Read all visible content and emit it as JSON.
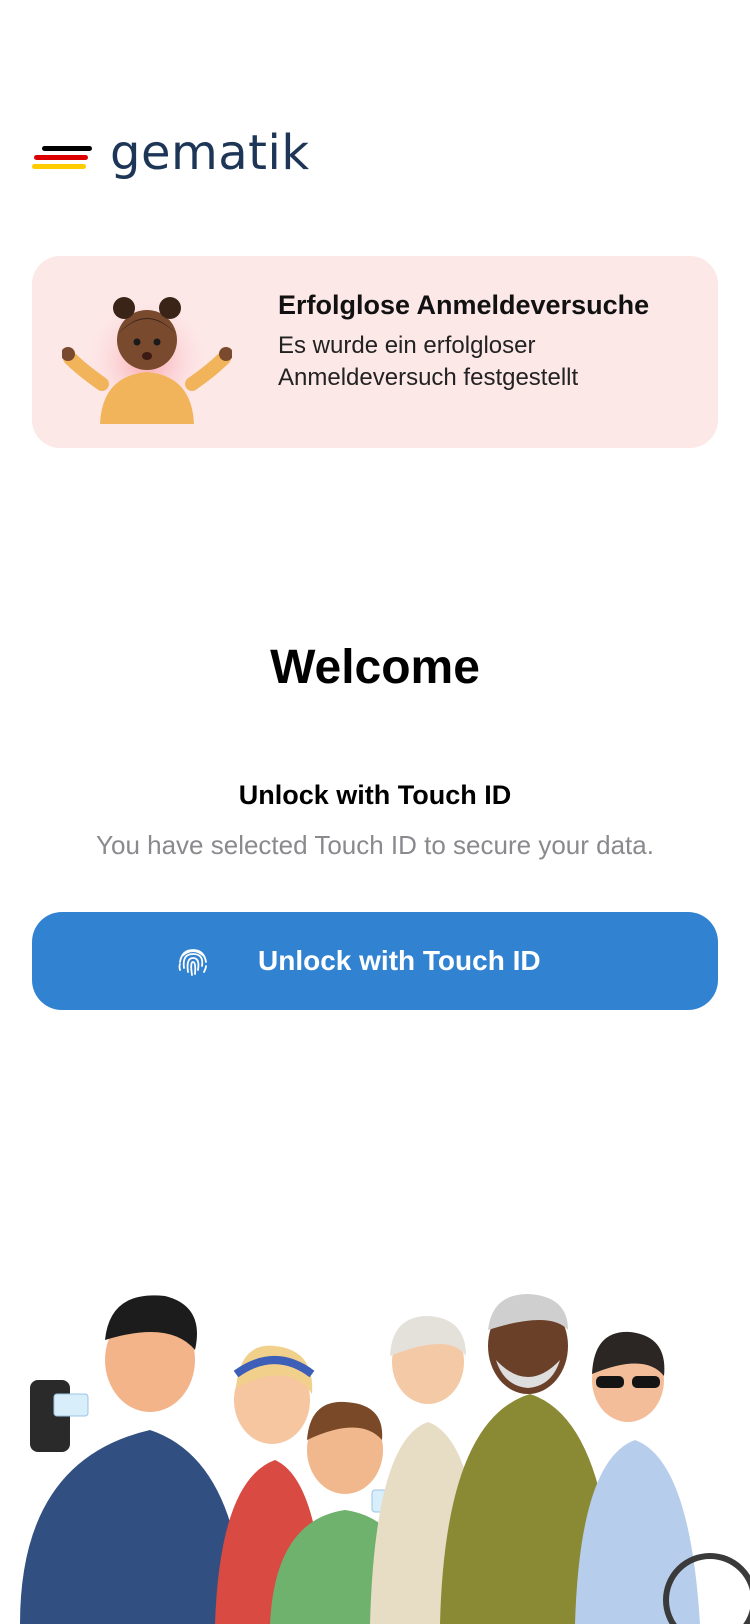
{
  "logo": {
    "text": "gematik",
    "flag_colors": [
      "#000000",
      "#dd0000",
      "#ffcc00"
    ]
  },
  "alert": {
    "title": "Erfolglose Anmeldeversuche",
    "message": "Es wurde ein erfolgloser Anmeldeversuch festgestellt",
    "background": "#fde8e8",
    "illustration": "shrugging-girl-illustration"
  },
  "welcome": {
    "title": "Welcome",
    "subtitle": "Unlock with Touch ID",
    "description": "You have selected Touch ID to secure your data."
  },
  "unlock_button": {
    "label": "Unlock with Touch ID",
    "icon": "fingerprint-icon",
    "color": "#3183d2"
  },
  "footer_illustration": "group-of-people-illustration"
}
